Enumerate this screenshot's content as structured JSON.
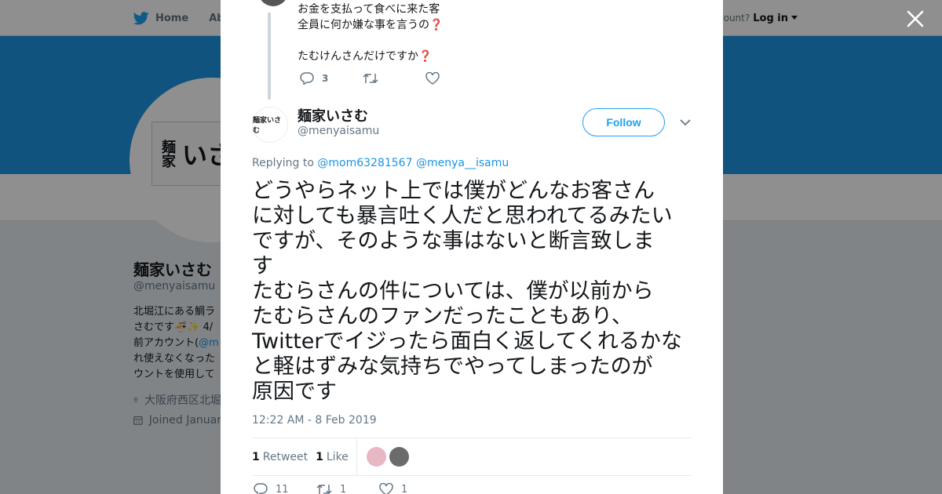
{
  "background": {
    "nav": {
      "home": "Home",
      "about": "Abo"
    },
    "account_prompt": "ccount?",
    "login": "Log in",
    "profile": {
      "name": "麺家いさむ",
      "handle": "@menyaisamu",
      "bio_line1": "北堀江にある鯛ラ",
      "bio_line2": "さむです🍜✨ 4/",
      "bio_line3_prefix": "前アカウント(",
      "bio_line3_link": "@m",
      "bio_line4": "れ使えなくなった",
      "bio_line5": "ウントを使用して",
      "location": "大阪府西区北堀",
      "joined": "Joined Januar"
    },
    "logo_text_vertical": "麺家",
    "logo_text": "いさ"
  },
  "modal": {
    "previous_tweet": {
      "line1": "お金を支払って食べに来た客",
      "line2": "全員に何か嫌な事を言うの",
      "line3": "たむけんさんだけですか",
      "q_mark": "❓",
      "reply_count": "3"
    },
    "author": {
      "name": "麺家いさむ",
      "handle": "@menyaisamu",
      "avatar_text": "麺家いさむ",
      "follow_label": "Follow"
    },
    "replying_label": "Replying to",
    "replying_to": [
      "@mom63281567",
      "@menya__isamu"
    ],
    "tweet_text": "どうやらネット上では僕がどんなお客さん\nに対しても暴言吐く人だと思われてるみたい\nですが、そのような事はないと断言致しま\nす\nたむらさんの件については、僕が以前から\nたむらさんのファンだったこともあり、\nTwitterでイジったら面白く返してくれるかな\nと軽はずみな気持ちでやってしまったのが\n原因です",
    "timestamp": "12:22 AM - 8 Feb 2019",
    "stats": {
      "retweet_count": "1",
      "retweet_label": "Retweet",
      "like_count": "1",
      "like_label": "Like"
    },
    "actions": {
      "reply_count": "11",
      "retweet_count": "1",
      "like_count": "1"
    }
  },
  "colors": {
    "twitter_blue": "#1da1f2",
    "banner": "#1b95e0",
    "question_red": "#d8243b"
  }
}
